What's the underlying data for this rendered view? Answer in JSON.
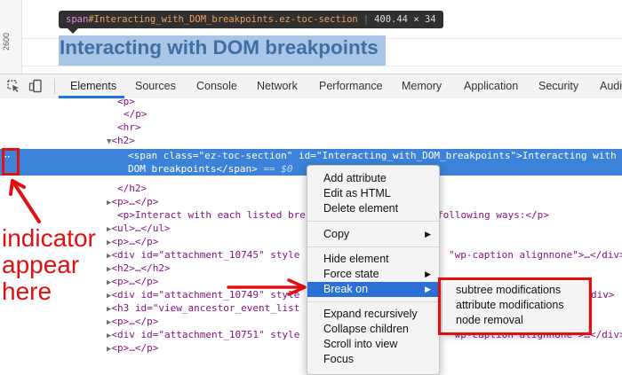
{
  "page": {
    "ruler_label": "2600",
    "heading": "Interacting with DOM breakpoints",
    "tooltip": {
      "tag": "span",
      "ident": "#Interacting_with_DOM_breakpoints.ez-toc-section",
      "dims": "400.44 × 34"
    }
  },
  "devtools": {
    "tabs": [
      "Elements",
      "Sources",
      "Console",
      "Network",
      "Performance",
      "Memory",
      "Application",
      "Security",
      "Audi"
    ],
    "active_tab": "Elements",
    "icons": [
      "inspect-element-icon",
      "device-toggle-icon"
    ]
  },
  "dom_lines": {
    "l0": "<p>",
    "l1": "</p>",
    "l2": "<hr>",
    "l3": "<h2>",
    "sel_a": "<span class=\"ez-toc-section\" id=\"Interacting_with_DOM_breakpoints\">Interacting with",
    "sel_b": "DOM breakpoints</span>",
    "sel_eq": " == $0",
    "l6": "</h2>",
    "l7": "<p>…</p>",
    "l8a": "<p>Interact with each listed bre",
    "l8b": "following ways:</p>",
    "l9": "<ul>…</ul>",
    "l10": "<p>…</p>",
    "l11a": "<div id=\"attachment_10745\" style",
    "l11b": "\"wp-caption alignnone\">…</div>",
    "l12": "<h2>…</h2>",
    "l13": "<p>…</p>",
    "l14a": "<div id=\"attachment_10749\" style",
    "l14b": "div>",
    "l15": "<h3 id=\"view_ancestor_event_list",
    "l16": "<p>…</p>",
    "l17a": "<div id=\"attachment_10751\" style",
    "l17b": "\"wp-caption alignnone\">…</div>",
    "l18": "<p>…</p>"
  },
  "context_menu": {
    "items": [
      {
        "label": "Add attribute"
      },
      {
        "label": "Edit as HTML"
      },
      {
        "label": "Delete element"
      },
      {
        "label": "Copy",
        "submenu": true
      },
      {
        "label": "Hide element"
      },
      {
        "label": "Force state",
        "submenu": true
      },
      {
        "label": "Break on",
        "submenu": true,
        "highlighted": true
      },
      {
        "label": "Expand recursively"
      },
      {
        "label": "Collapse children"
      },
      {
        "label": "Scroll into view"
      },
      {
        "label": "Focus"
      }
    ],
    "arrow_glyph": "▶"
  },
  "submenu": {
    "items": [
      "subtree modifications",
      "attribute modifications",
      "node removal"
    ]
  },
  "annotation": {
    "dots": "··",
    "lines": [
      "indicator",
      "appear",
      "here"
    ],
    "color": "#e01010"
  },
  "colors": {
    "selection": "#3b82d8",
    "menu_highlight": "#2a6fd6",
    "tag": "#881280",
    "attr_name": "#994500",
    "attr_value": "#1a1aa6"
  }
}
